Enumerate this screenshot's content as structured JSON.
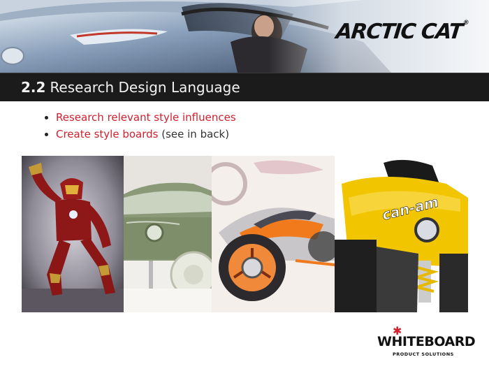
{
  "header": {
    "brand": "ARCTIC CAT",
    "brand_mark": "®",
    "section_number": "2.2",
    "title": "Research Design Language"
  },
  "bullets": [
    {
      "text": "Research relevant style influences",
      "note": ""
    },
    {
      "text": "Create style boards",
      "note": " (see in back)"
    }
  ],
  "gallery": [
    {
      "id": "iron-man-image"
    },
    {
      "id": "concept-car-image"
    },
    {
      "id": "concept-motorcycle-sketch"
    },
    {
      "id": "can-am-atv-image"
    }
  ],
  "footer": {
    "logo_word": "WHITEBOARD",
    "logo_sub": "PRODUCT SOLUTIONS"
  },
  "colors": {
    "accent_red": "#d2202f",
    "title_bar": "#1b1b1b",
    "atv_yellow": "#f1c500"
  }
}
